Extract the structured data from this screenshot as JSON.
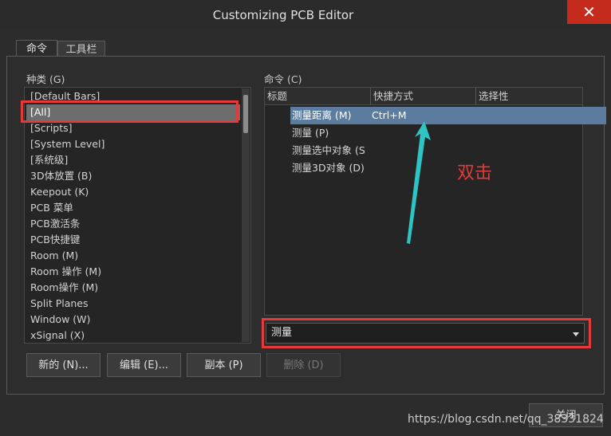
{
  "window": {
    "title": "Customizing PCB Editor",
    "close_glyph": "✕"
  },
  "tabs": [
    {
      "label": "命令"
    },
    {
      "label": "工具栏"
    }
  ],
  "categories": {
    "label": "种类 (G)",
    "items": [
      "[Default Bars]",
      "[All]",
      "[Scripts]",
      "[System Level]",
      "[系统级]",
      "3D体放置 (B)",
      "Keepout (K)",
      "PCB 菜单",
      "PCB激活条",
      "PCB快捷键",
      "Room (M)",
      "Room 操作 (M)",
      "Room操作 (M)",
      "Split Planes",
      "Window (W)",
      "xSignal (X)"
    ],
    "selected_index": 1
  },
  "commands": {
    "label": "命令 (C)",
    "columns": [
      "标题",
      "快捷方式",
      "选择性"
    ],
    "rows": [
      {
        "title": "测量距离 (M)",
        "shortcut": "Ctrl+M"
      },
      {
        "title": "测量 (P)",
        "shortcut": ""
      },
      {
        "title": "测量选中对象 (S",
        "shortcut": ""
      },
      {
        "title": "测量3D对象 (D)",
        "shortcut": ""
      }
    ],
    "selected_index": 0
  },
  "annotation": {
    "text": "双击",
    "color": "#e53a3a"
  },
  "filter_combo": {
    "value": "测量"
  },
  "buttons": {
    "new": "新的 (N)...",
    "edit": "编辑 (E)...",
    "copy": "副本 (P)",
    "delete": "删除 (D)",
    "close": "关闭"
  },
  "watermark": "https://blog.csdn.net/qq_38331824",
  "colors": {
    "highlight_red": "#e53a3a",
    "selection_blue": "#5b7c9e",
    "selection_gray": "#6d6d6d",
    "arrow_cyan": "#2ec4c4"
  }
}
